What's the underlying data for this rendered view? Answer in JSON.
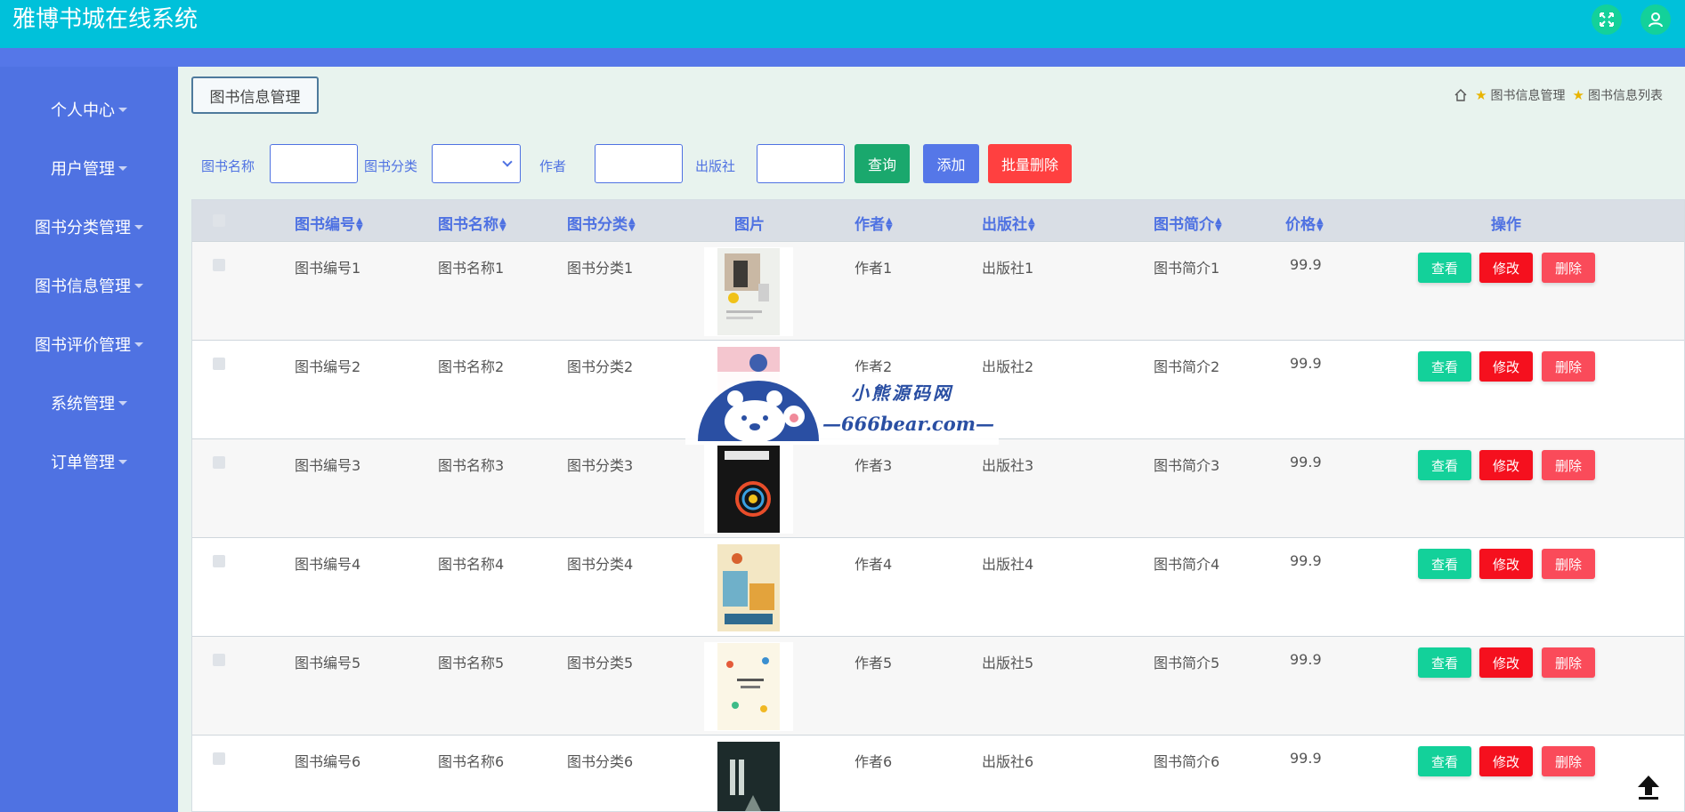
{
  "app": {
    "title": "雅博书城在线系统"
  },
  "header": {
    "fullscreen_icon": "expand-icon",
    "user_icon": "user-icon"
  },
  "sidebar": {
    "items": [
      {
        "label": "个人中心"
      },
      {
        "label": "用户管理"
      },
      {
        "label": "图书分类管理"
      },
      {
        "label": "图书信息管理"
      },
      {
        "label": "图书评价管理"
      },
      {
        "label": "系统管理"
      },
      {
        "label": "订单管理"
      }
    ]
  },
  "tab": {
    "label": "图书信息管理"
  },
  "breadcrumb": {
    "items": [
      "图书信息管理",
      "图书信息列表"
    ]
  },
  "search": {
    "name_label": "图书名称",
    "category_label": "图书分类",
    "author_label": "作者",
    "publisher_label": "出版社",
    "query_button": "查询",
    "add_button": "添加",
    "batch_delete_button": "批量删除"
  },
  "table": {
    "headers": {
      "code": "图书编号",
      "name": "图书名称",
      "category": "图书分类",
      "image": "图片",
      "author": "作者",
      "publisher": "出版社",
      "intro": "图书简介",
      "price": "价格",
      "actions": "操作"
    },
    "action_labels": {
      "view": "查看",
      "edit": "修改",
      "delete": "删除"
    },
    "rows": [
      {
        "code": "图书编号1",
        "name": "图书名称1",
        "category": "图书分类1",
        "author": "作者1",
        "publisher": "出版社1",
        "intro": "图书简介1",
        "price": "99.9"
      },
      {
        "code": "图书编号2",
        "name": "图书名称2",
        "category": "图书分类2",
        "author": "作者2",
        "publisher": "出版社2",
        "intro": "图书简介2",
        "price": "99.9"
      },
      {
        "code": "图书编号3",
        "name": "图书名称3",
        "category": "图书分类3",
        "author": "作者3",
        "publisher": "出版社3",
        "intro": "图书简介3",
        "price": "99.9"
      },
      {
        "code": "图书编号4",
        "name": "图书名称4",
        "category": "图书分类4",
        "author": "作者4",
        "publisher": "出版社4",
        "intro": "图书简介4",
        "price": "99.9"
      },
      {
        "code": "图书编号5",
        "name": "图书名称5",
        "category": "图书分类5",
        "author": "作者5",
        "publisher": "出版社5",
        "intro": "图书简介5",
        "price": "99.9"
      },
      {
        "code": "图书编号6",
        "name": "图书名称6",
        "category": "图书分类6",
        "author": "作者6",
        "publisher": "出版社6",
        "intro": "图书简介6",
        "price": "99.9"
      }
    ]
  },
  "watermark": {
    "title": "小熊源码网",
    "url": "—666bear.com—"
  },
  "colors": {
    "header": "#00c1da",
    "sidebar": "#4f72e2",
    "view_button": "#13d19a",
    "edit_button": "#f5101e",
    "delete_button": "#fa4b5a",
    "query_button": "#1aa86d",
    "add_button": "#5577e8",
    "batch_delete_button": "#ff4040"
  }
}
